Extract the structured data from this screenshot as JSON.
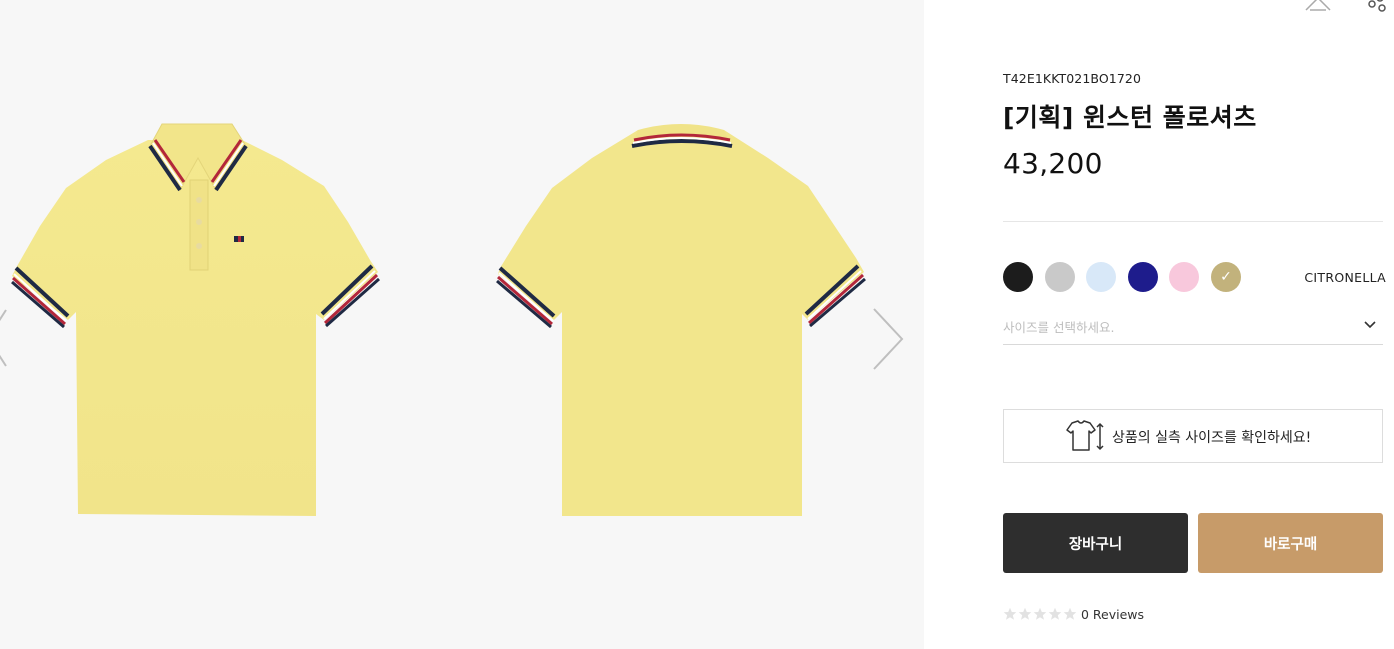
{
  "product": {
    "sku": "T42E1KKT021BO1720",
    "title": "[기획] 윈스턴 폴로셔츠",
    "price": "43,200",
    "selected_color": "CITRONELLA"
  },
  "swatches": [
    {
      "color": "#1c1c1c",
      "selected": false
    },
    {
      "color": "#c9c9c9",
      "selected": false
    },
    {
      "color": "#d8e8f8",
      "selected": false
    },
    {
      "color": "#1e1c8c",
      "selected": false
    },
    {
      "color": "#f8c8dc",
      "selected": false
    },
    {
      "color": "#c2b27c",
      "selected": true
    }
  ],
  "size_select": {
    "placeholder": "사이즈를 선택하세요."
  },
  "size_guide": {
    "label": "상품의 실측 사이즈를 확인하세요!"
  },
  "actions": {
    "cart_label": "장바구니",
    "buy_label": "바로구매"
  },
  "reviews": {
    "rating": 0,
    "max_rating": 5,
    "label": "0 Reviews"
  },
  "colors": {
    "shirt": "#f3e68f",
    "stripe_navy": "#1f2a44",
    "stripe_red": "#b3273a",
    "cart_button": "#2e2e2e",
    "buy_button": "#c79b69",
    "gallery_bg": "#f7f7f7"
  },
  "icons": {
    "prev": "chevron-left-icon",
    "next": "chevron-right-icon",
    "dropdown": "chevron-down-icon",
    "size_guide": "shirt-measure-icon",
    "star": "star-icon"
  }
}
